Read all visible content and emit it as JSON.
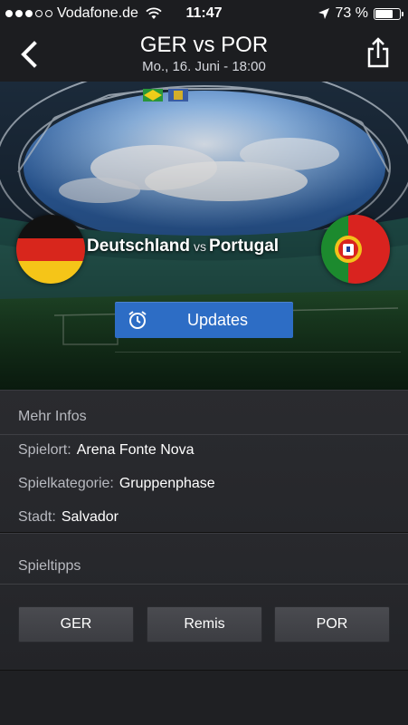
{
  "status_bar": {
    "carrier": "Vodafone.de",
    "time": "11:47",
    "battery": "73 %",
    "battery_level": 0.73
  },
  "nav": {
    "title": "GER vs POR",
    "subtitle": "Mo., 16. Juni - 18:00"
  },
  "match": {
    "home_team": "Deutschland",
    "vs": "vs",
    "away_team": "Portugal",
    "updates_label": "Updates"
  },
  "info": {
    "section_title": "Mehr Infos",
    "venue_label": "Spielort:",
    "venue_value": "Arena Fonte Nova",
    "category_label": "Spielkategorie:",
    "category_value": "Gruppenphase",
    "city_label": "Stadt:",
    "city_value": "Salvador"
  },
  "tips": {
    "section_title": "Spieltipps",
    "buttons": [
      "GER",
      "Remis",
      "POR"
    ]
  },
  "colors": {
    "accent_button": "#2d6dc5",
    "background": "#1c1d20"
  }
}
